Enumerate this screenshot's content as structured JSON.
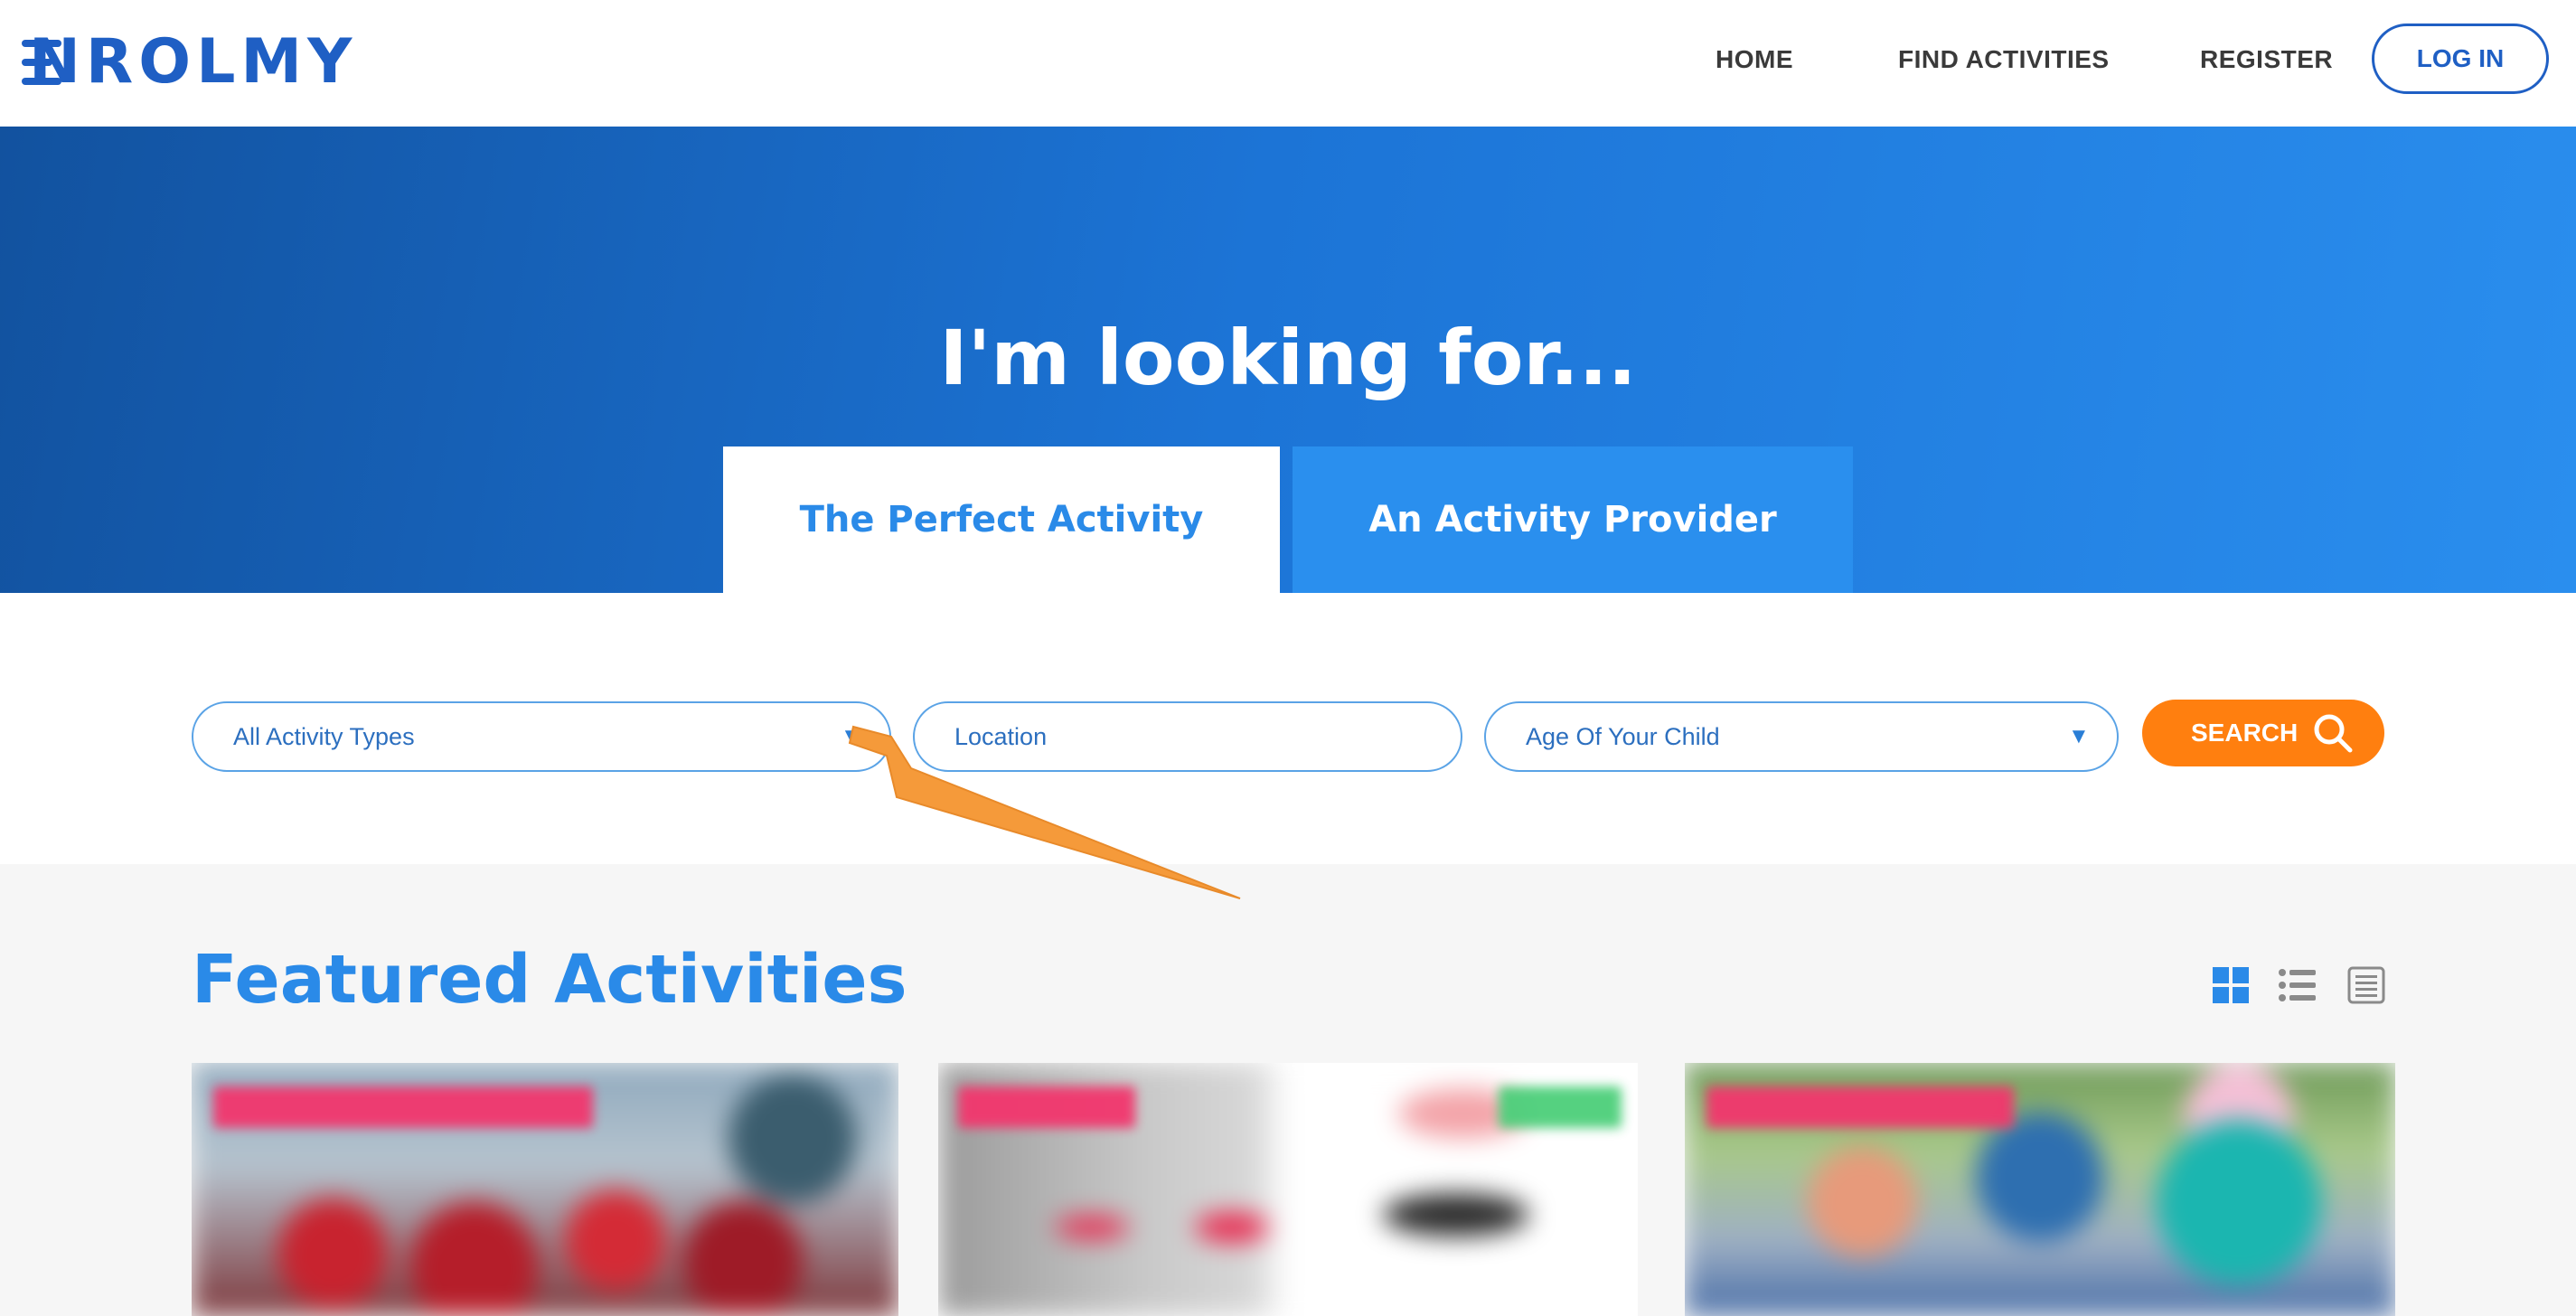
{
  "brand": {
    "name": "NROLMY"
  },
  "nav": {
    "items": [
      {
        "label": "HOME"
      },
      {
        "label": "FIND ACTIVITIES"
      },
      {
        "label": "REGISTER"
      }
    ],
    "login_label": "LOG IN"
  },
  "hero": {
    "title": "I'm looking for...",
    "tabs": [
      {
        "label": "The Perfect Activity",
        "active": true
      },
      {
        "label": "An Activity Provider",
        "active": false
      }
    ]
  },
  "search": {
    "activity_type": {
      "value": "All Activity Types",
      "icon": "caret-down-icon"
    },
    "location": {
      "placeholder": "Location"
    },
    "age": {
      "value": "Age Of Your Child",
      "icon": "caret-down-icon"
    },
    "button_label": "SEARCH",
    "button_icon": "search-icon"
  },
  "featured": {
    "title": "Featured Activities",
    "views": [
      "grid-view-icon",
      "list-view-icon",
      "detail-view-icon"
    ]
  },
  "colors": {
    "brand_blue": "#1f5fc4",
    "accent_blue": "#2a8ae8",
    "search_orange": "#ff7f0f",
    "annotation_arrow": "#f59a3a"
  }
}
